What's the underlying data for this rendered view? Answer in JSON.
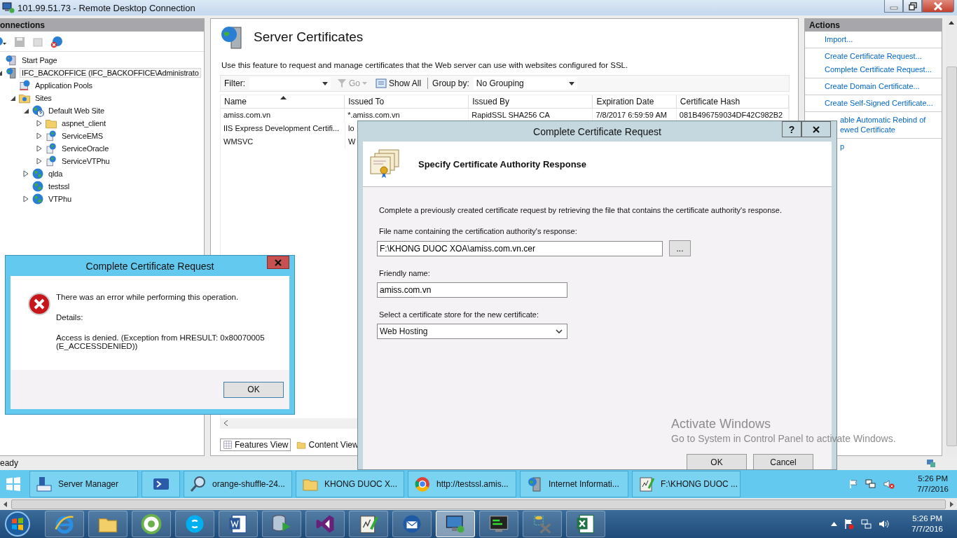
{
  "rdp_window": {
    "title": "101.99.51.73 - Remote Desktop Connection"
  },
  "connections": {
    "title": "onnections",
    "tree": [
      {
        "label": "Start Page",
        "kind": "page",
        "expandable": false,
        "selected": false
      },
      {
        "label": "IFC_BACKOFFICE (IFC_BACKOFFICE\\Administrato",
        "kind": "server",
        "expandable": true,
        "expanded": true,
        "selected": true,
        "children": [
          {
            "label": "Application Pools",
            "kind": "pools",
            "expandable": false,
            "selected": false
          },
          {
            "label": "Sites",
            "kind": "sites",
            "expandable": true,
            "expanded": true,
            "selected": false,
            "children": [
              {
                "label": "Default Web Site",
                "kind": "site",
                "expandable": true,
                "expanded": true,
                "selected": false,
                "children": [
                  {
                    "label": "aspnet_client",
                    "kind": "folder",
                    "expandable": true,
                    "expanded": false,
                    "selected": false
                  },
                  {
                    "label": "ServiceEMS",
                    "kind": "app",
                    "expandable": true,
                    "expanded": false,
                    "selected": false
                  },
                  {
                    "label": "ServiceOracle",
                    "kind": "app",
                    "expandable": true,
                    "expanded": false,
                    "selected": false
                  },
                  {
                    "label": "ServiceVTPhu",
                    "kind": "app",
                    "expandable": true,
                    "expanded": false,
                    "selected": false
                  }
                ]
              },
              {
                "label": "qlda",
                "kind": "globe",
                "expandable": true,
                "expanded": false,
                "selected": false
              },
              {
                "label": "testssl",
                "kind": "globe",
                "expandable": false,
                "selected": false
              },
              {
                "label": "VTPhu",
                "kind": "globe",
                "expandable": true,
                "expanded": false,
                "selected": false
              }
            ]
          }
        ]
      }
    ]
  },
  "server_certificates": {
    "title": "Server Certificates",
    "description": "Use this feature to request and manage certificates that the Web server can use with websites configured for SSL.",
    "filter": {
      "label": "Filter:",
      "go": "Go",
      "show_all": "Show All",
      "group_by_label": "Group by:",
      "group_by_value": "No Grouping"
    },
    "table": {
      "columns": [
        {
          "label": "Name",
          "sorted": true
        },
        {
          "label": "Issued To",
          "sorted": false
        },
        {
          "label": "Issued By",
          "sorted": false
        },
        {
          "label": "Expiration Date",
          "sorted": false
        },
        {
          "label": "Certificate Hash",
          "sorted": false
        }
      ],
      "rows": [
        [
          "amiss.com.vn",
          "*.amiss.com.vn",
          "RapidSSL SHA256 CA",
          "7/8/2017 6:59:59 AM",
          "081B496759034DF42C982B2"
        ],
        [
          "IIS Express Development Certifi...",
          "lo"
        ],
        [
          "WMSVC",
          "W"
        ]
      ]
    },
    "view_tabs": [
      {
        "label": "Features View",
        "kind": "features",
        "selected": true
      },
      {
        "label": "Content View",
        "kind": "content",
        "selected": false
      }
    ]
  },
  "actions": {
    "title": "Actions",
    "groups": [
      [
        "Import..."
      ],
      [
        "Create Certificate Request...",
        "Complete Certificate Request..."
      ],
      [
        "Create Domain Certificate..."
      ],
      [
        "Create Self-Signed Certificate..."
      ],
      [
        "able Automatic Rebind of ewed Certificate"
      ],
      [
        "p"
      ]
    ]
  },
  "status_bar": {
    "text": "eady"
  },
  "error_dialog": {
    "title": "Complete Certificate Request",
    "message": "There was an error while performing this operation.",
    "details_label": "Details:",
    "details": "Access is denied. (Exception from HRESULT: 0x80070005 (E_ACCESSDENIED))",
    "ok": "OK"
  },
  "request_dialog": {
    "title": "Complete Certificate Request",
    "help": "?",
    "heading": "Specify Certificate Authority Response",
    "intro": "Complete a previously created certificate request by retrieving the file that contains the certificate authority's response.",
    "file_label": "File name containing the certification authority's response:",
    "file_value": "F:\\KHONG DUOC XOA\\amiss.com.vn.cer",
    "browse": "...",
    "friendly_label": "Friendly name:",
    "friendly_value": "amiss.com.vn",
    "store_label": "Select a certificate store for the new certificate:",
    "store_value": "Web Hosting",
    "ok": "OK",
    "cancel": "Cancel"
  },
  "activation_notice": {
    "title": "Activate Windows",
    "text": "Go to System in Control Panel to activate Windows."
  },
  "remote_taskbar": {
    "items": [
      {
        "kind": "start"
      },
      {
        "kind": "server-manager",
        "label": "Server Manager"
      },
      {
        "kind": "powershell"
      },
      {
        "kind": "search",
        "label": "orange-shuffle-24..."
      },
      {
        "kind": "explorer",
        "label": "KHONG DUOC X..."
      },
      {
        "kind": "chrome",
        "label": "http://testssl.amis..."
      },
      {
        "kind": "iis",
        "label": "Internet Informati..."
      },
      {
        "kind": "notepad",
        "label": "F:\\KHONG DUOC ..."
      }
    ],
    "clock": {
      "time": "5:26 PM",
      "date": "7/7/2016"
    }
  },
  "local_taskbar": {
    "items": [
      {
        "kind": "ie",
        "selected": false
      },
      {
        "kind": "explorer",
        "selected": false
      },
      {
        "kind": "green",
        "selected": false
      },
      {
        "kind": "skype",
        "selected": false
      },
      {
        "kind": "word",
        "selected": false
      },
      {
        "kind": "database",
        "selected": false
      },
      {
        "kind": "vs",
        "selected": false
      },
      {
        "kind": "notepad",
        "selected": false
      },
      {
        "kind": "mail",
        "selected": false
      },
      {
        "kind": "remote",
        "selected": true
      },
      {
        "kind": "terminal",
        "selected": false
      },
      {
        "kind": "tools",
        "selected": false
      },
      {
        "kind": "excel",
        "selected": false
      }
    ],
    "clock": {
      "time": "5:26 PM",
      "date": "7/7/2016"
    }
  }
}
